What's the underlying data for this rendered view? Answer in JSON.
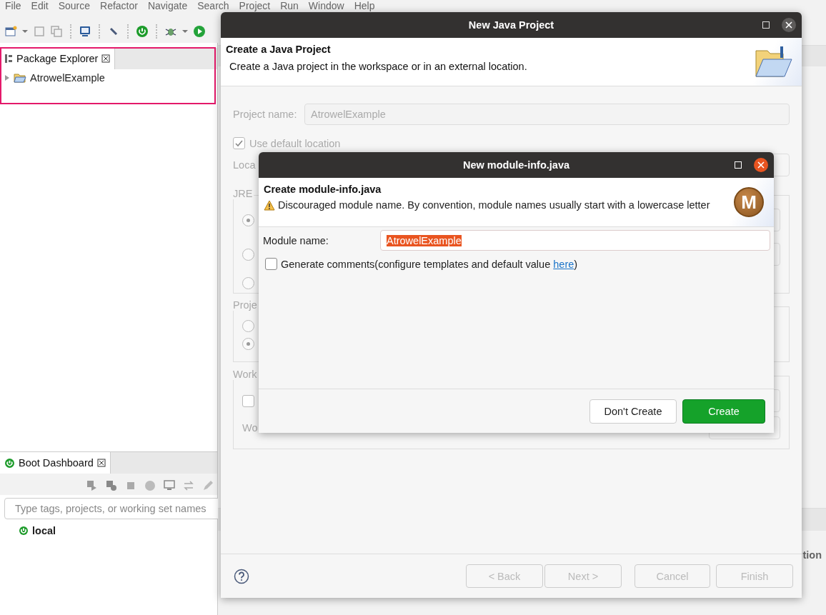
{
  "menu_bar": [
    "File",
    "Edit",
    "Source",
    "Refactor",
    "Navigate",
    "Search",
    "Project",
    "Run",
    "Window",
    "Help"
  ],
  "package_explorer": {
    "tab": "Package Explorer",
    "items": [
      {
        "label": "AtrowelExample",
        "expanded": false
      }
    ]
  },
  "boot_dashboard": {
    "tab": "Boot Dashboard",
    "search": {
      "placeholder": "Type tags, projects, or working set names"
    },
    "items": [
      {
        "label": "local"
      }
    ]
  },
  "right_panel": {
    "column_fragment": "tion"
  },
  "java_project_dialog": {
    "title": "New Java Project",
    "header_title": "Create a Java Project",
    "header_message": "Create a Java project in the workspace or in an external location.",
    "project_name": {
      "label": "Project name:",
      "value": "AtrowelExample",
      "disabled": true
    },
    "use_default_location": {
      "label": "Use default location",
      "checked": true,
      "disabled": true
    },
    "location_label": "Loca",
    "jre_group": {
      "label": "JRE",
      "options": [
        {
          "selected": true
        },
        {
          "selected": false
        },
        {
          "selected": false
        }
      ]
    },
    "project_layout_group": {
      "label": "Proje",
      "options": [
        {
          "selected": false
        },
        {
          "selected": true
        }
      ]
    },
    "working_sets_group": {
      "label": "Work",
      "checked": false,
      "field_label": "Wo"
    },
    "buttons": [
      {
        "label": "< Back",
        "disabled": true
      },
      {
        "label": "Next >",
        "disabled": true
      },
      {
        "label": "Cancel",
        "disabled": true
      },
      {
        "label": "Finish",
        "disabled": true
      }
    ]
  },
  "module_dialog": {
    "title": "New module-info.java",
    "header_title": "Create module-info.java",
    "warning": "Discouraged module name. By convention, module names usually start with a lowercase letter",
    "badge": "M",
    "module_name": {
      "label": "Module name:",
      "value": "AtrowelExample",
      "selected": true
    },
    "generate_comments": {
      "checked": false,
      "text": "Generate comments(configure templates and default value ",
      "link": "here",
      "suffix": ")"
    },
    "buttons": [
      {
        "label": "Don't Create",
        "kind": "secondary"
      },
      {
        "label": "Create",
        "kind": "primary"
      }
    ]
  }
}
